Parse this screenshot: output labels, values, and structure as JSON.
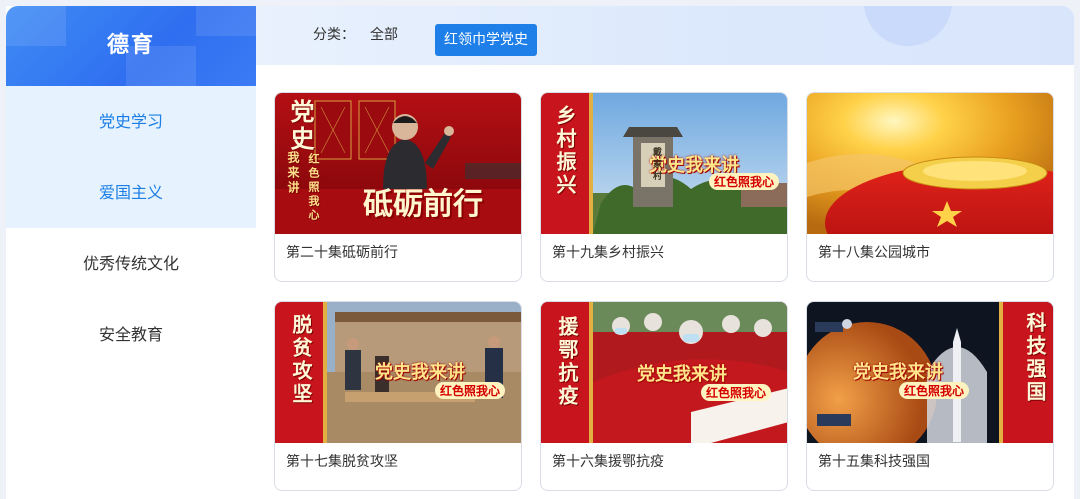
{
  "sidebar": {
    "title": "德育",
    "items": [
      {
        "label": "党史学习",
        "state": "active"
      },
      {
        "label": "爱国主义",
        "state": "highlight"
      },
      {
        "label": "优秀传统文化",
        "state": "normal"
      },
      {
        "label": "安全教育",
        "state": "normal"
      }
    ]
  },
  "filter": {
    "label": "分类：",
    "all": "全部",
    "selected": "红领巾学党史"
  },
  "cards": [
    {
      "title": "第二十集砥砺前行",
      "overlay": {
        "vertical": "党史",
        "sub": "我来讲",
        "heart": "红色照我心",
        "headline": "砥砺前行"
      }
    },
    {
      "title": "第十九集乡村振兴",
      "overlay": {
        "vertical": "乡村振兴",
        "slogan": "党史我来讲",
        "heart": "红色照我心",
        "sign": "戴 家 村"
      }
    },
    {
      "title": "第十八集公园城市",
      "overlay": {}
    },
    {
      "title": "第十七集脱贫攻坚",
      "overlay": {
        "vertical": "脱贫攻坚",
        "slogan": "党史我来讲",
        "heart": "红色照我心"
      }
    },
    {
      "title": "第十六集援鄂抗疫",
      "overlay": {
        "vertical": "援鄂抗疫",
        "slogan": "党史我来讲",
        "heart": "红色照我心"
      }
    },
    {
      "title": "第十五集科技强国",
      "overlay": {
        "vertical": "科技强国",
        "slogan": "党史我来讲",
        "heart": "红色照我心"
      }
    }
  ],
  "colors": {
    "accent": "#1f7fe8",
    "brand": "#2f6ef0",
    "sidebar_active_bg": "#e6f2fe",
    "theme_red": "#c8141c"
  }
}
